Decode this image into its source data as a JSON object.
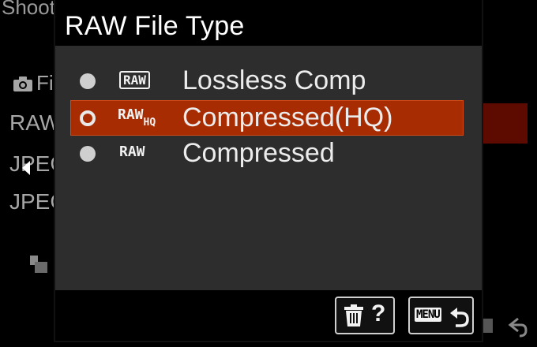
{
  "background": {
    "title": "Shoot",
    "rows": [
      {
        "label": "Fi"
      },
      {
        "label": "RAW"
      },
      {
        "label": "JPEG"
      },
      {
        "label": "JPEG"
      }
    ]
  },
  "dialog": {
    "title": "RAW File Type",
    "options": [
      {
        "badge": "RAW",
        "label": "Lossless Comp",
        "selected": false
      },
      {
        "badge": "RAW",
        "badge_sub": "HQ",
        "label": "Compressed(HQ)",
        "selected": true
      },
      {
        "badge": "RAW",
        "label": "Compressed",
        "selected": false
      }
    ],
    "footer": {
      "help_label": "?",
      "menu_label": "MENU"
    }
  },
  "colors": {
    "dialog_bg": "#2d2d2d",
    "header_bg": "#000000",
    "selection": "#a82c02",
    "text": "#ececec"
  }
}
